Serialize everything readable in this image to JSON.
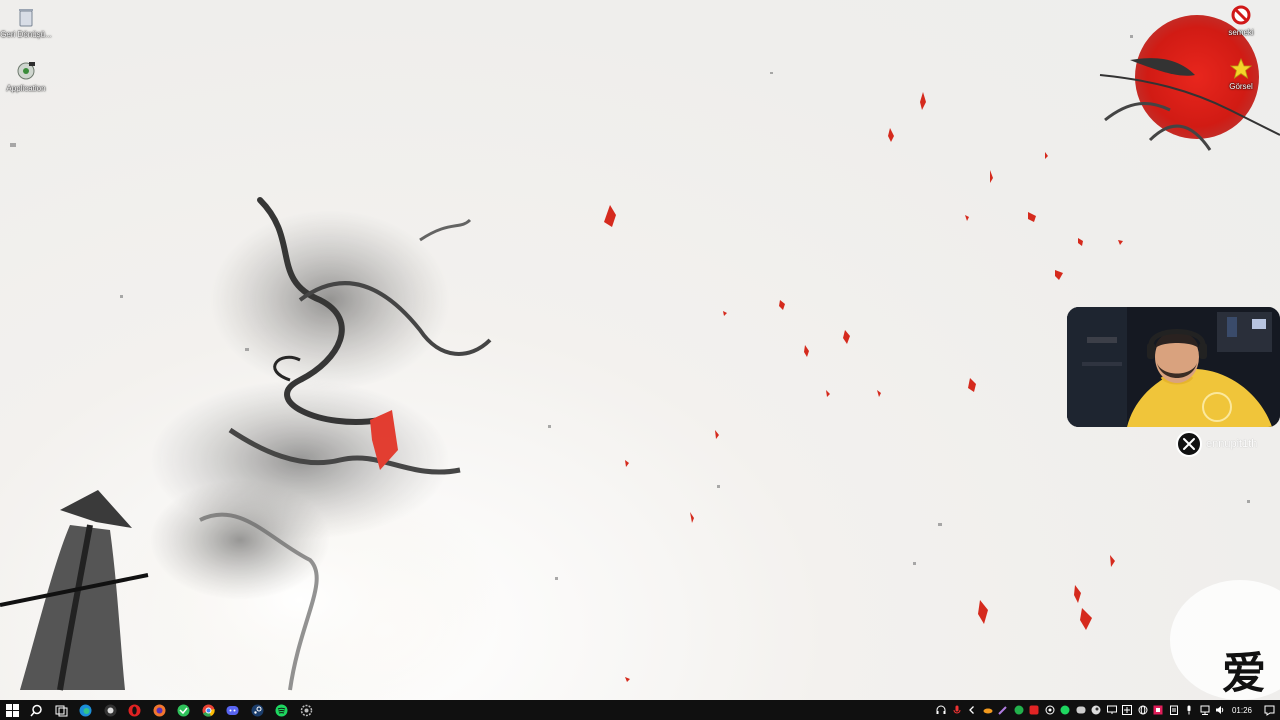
{
  "desktop": {
    "icons": [
      {
        "label": "Geri Dönüşü...",
        "icon": "recycle-bin-icon"
      },
      {
        "label": "Application",
        "icon": "application-icon"
      },
      {
        "label": "semeki",
        "icon": "no-entry-icon"
      },
      {
        "label": "Görsel",
        "icon": "star-icon"
      }
    ],
    "kanji": "爱",
    "accent": "#d42020"
  },
  "overlay": {
    "social_icon": "x-logo-icon",
    "handle": "ennupit1th"
  },
  "taskbar": {
    "apps": [
      "windows-start-icon",
      "search-icon",
      "task-view-icon",
      "edge-icon",
      "obs-icon",
      "opera-icon",
      "firefox-icon",
      "spotify-green-icon",
      "chrome-icon",
      "discord-icon",
      "steam-icon",
      "spotify-icon",
      "settings-icon"
    ],
    "tray": [
      "headset-icon",
      "microphone-icon",
      "chevron-icon",
      "cloud-icon",
      "pen-icon",
      "green-app-icon",
      "red-app-icon",
      "whatsapp-icon",
      "spotify-tray-icon",
      "discord-tray-icon",
      "steam-tray-icon",
      "display-icon",
      "game-icon",
      "globe-icon",
      "red-badge-icon",
      "clipboard-icon",
      "mic-tray-icon",
      "network-icon",
      "volume-icon"
    ],
    "time": "01:26"
  }
}
